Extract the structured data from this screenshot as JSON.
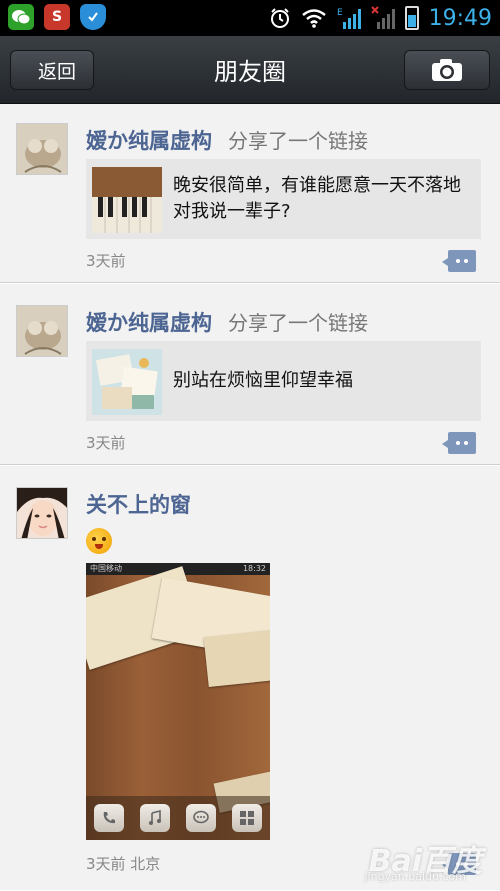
{
  "status_bar": {
    "time": "19:49",
    "left_icons": [
      "wechat-icon",
      "s-app-icon",
      "shield-icon"
    ],
    "right_icons": [
      "alarm-icon",
      "wifi-icon",
      "signal-icon",
      "signal-x-icon",
      "battery-charging-icon"
    ]
  },
  "header": {
    "back_label": "返回",
    "title": "朋友圈",
    "camera_icon": "camera-icon"
  },
  "posts": [
    {
      "author": "嫒か纯属虚构",
      "action": "分享了一个链接",
      "link_text": "晚安很简单，有谁能愿意一天不落地对我说一辈子?",
      "time": "3天前"
    },
    {
      "author": "嫒か纯属虚构",
      "action": "分享了一个链接",
      "link_text": "别站在烦恼里仰望幸福",
      "time": "3天前"
    },
    {
      "author": "关不上的窗",
      "emoji": "smile-emoji",
      "photo_status_left": "中国移动",
      "photo_status_right": "18:32",
      "time": "3天前 北京"
    }
  ],
  "watermark": {
    "main": "Bai百度",
    "sub": "jingyan.baidu.com"
  },
  "colors": {
    "name_blue": "#4d6592",
    "accent_time": "#3db0e8",
    "comment_btn": "#7f96bb"
  }
}
